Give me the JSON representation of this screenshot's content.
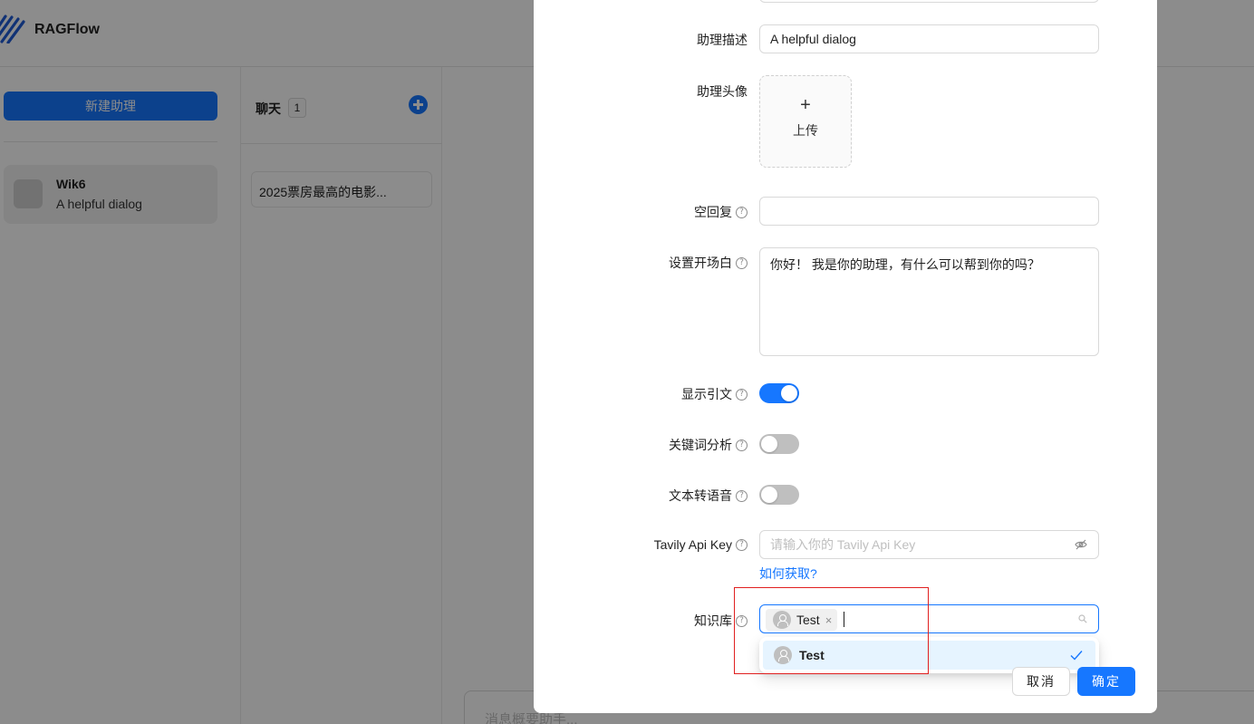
{
  "app": {
    "brand": "RAGFlow"
  },
  "left_panel": {
    "new_button": "新建助理",
    "assistant": {
      "name": "Wik6",
      "description": "A helpful dialog"
    }
  },
  "mid_panel": {
    "title": "聊天",
    "count": "1",
    "chat_item": "2025票房最高的电影..."
  },
  "message_input": {
    "placeholder": "消息概要助手..."
  },
  "modal": {
    "fields": {
      "description": {
        "label": "助理描述",
        "value": "A helpful dialog"
      },
      "avatar": {
        "label": "助理头像",
        "upload_plus": "+",
        "upload_text": "上传"
      },
      "empty_reply": {
        "label": "空回复",
        "value": ""
      },
      "opener": {
        "label": "设置开场白",
        "value": "你好！ 我是你的助理，有什么可以帮到你的吗？"
      },
      "show_quote": {
        "label": "显示引文",
        "enabled": true
      },
      "keyword_analysis": {
        "label": "关键词分析",
        "enabled": false
      },
      "tts": {
        "label": "文本转语音",
        "enabled": false
      },
      "tavily": {
        "label": "Tavily Api Key",
        "placeholder": "请输入你的 Tavily Api Key",
        "help_link": "如何获取?"
      },
      "knowledge_base": {
        "label": "知识库",
        "selected_tag": "Test",
        "tag_close": "×",
        "options": [
          {
            "label": "Test",
            "selected": true
          }
        ]
      }
    },
    "help_glyph": "?",
    "cancel": "取消",
    "ok": "确定"
  },
  "colors": {
    "primary": "#1677ff",
    "highlight_border": "#e02020",
    "switch_off": "#bfbfbf"
  }
}
